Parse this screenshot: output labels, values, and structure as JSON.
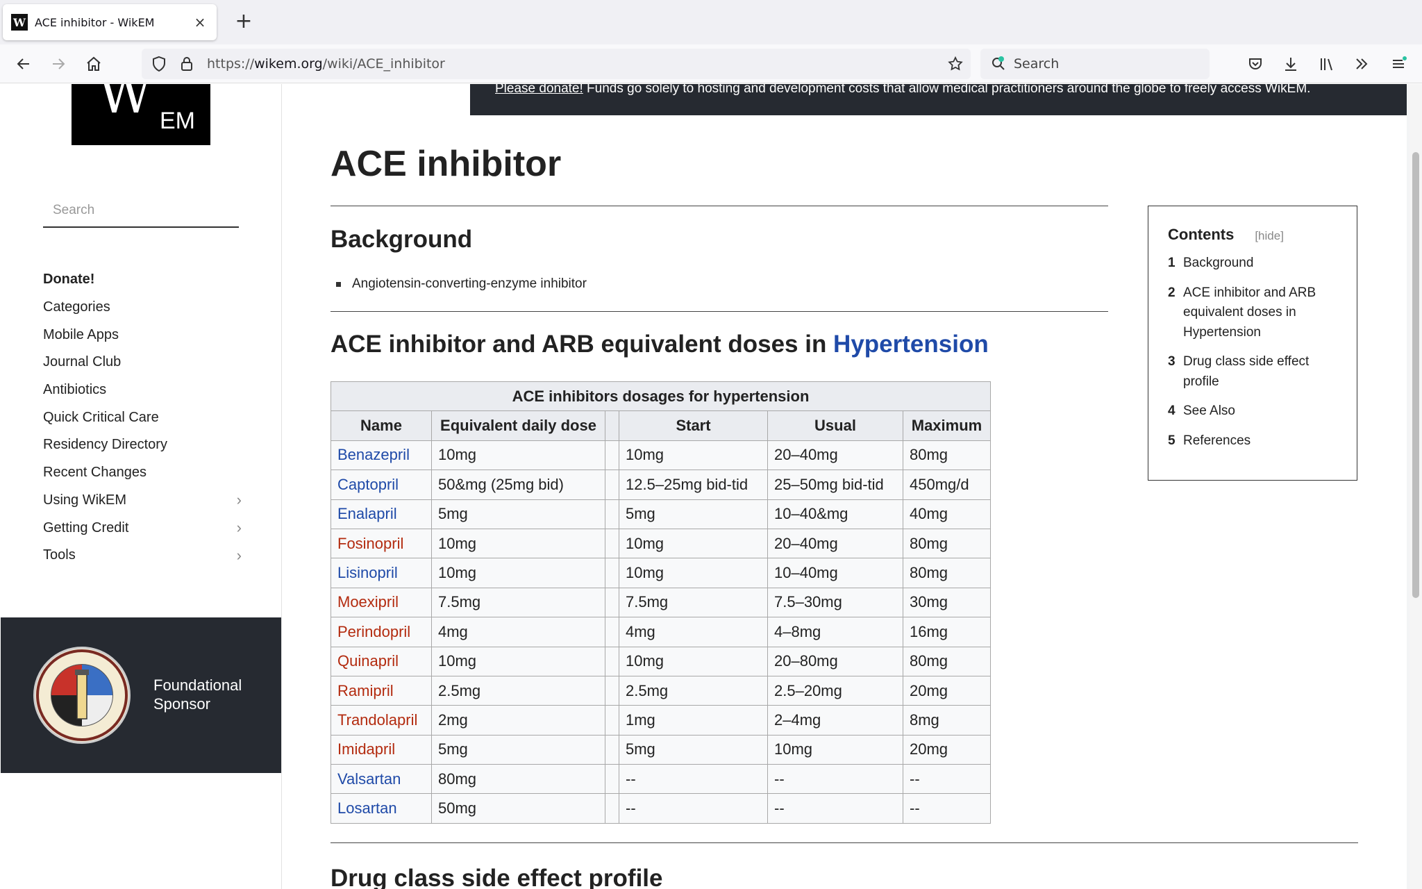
{
  "browser": {
    "tab_title": "ACE inhibitor - WikEM",
    "favicon_letter": "W",
    "new_tab": "+",
    "url_prefix": "https://",
    "url_domain": "wikem.org",
    "url_path": "/wiki/ACE_inhibitor",
    "search_placeholder": "Search"
  },
  "sidebar": {
    "logo_w": "W",
    "logo_em": "EM",
    "search_placeholder": "Search",
    "items": [
      {
        "label": "Donate!"
      },
      {
        "label": "Categories"
      },
      {
        "label": "Mobile Apps"
      },
      {
        "label": "Journal Club"
      },
      {
        "label": "Antibiotics"
      },
      {
        "label": "Quick Critical Care"
      },
      {
        "label": "Residency Directory"
      },
      {
        "label": "Recent Changes"
      },
      {
        "label": "Using WikEM"
      },
      {
        "label": "Getting Credit"
      },
      {
        "label": "Tools"
      }
    ],
    "sponsor_line1": "Foundational",
    "sponsor_line2": "Sponsor",
    "seal_top": "HARBOR-UCLA",
    "seal_bottom": "DEPARTMENT OF EMERGENCY MEDICINE"
  },
  "banner": {
    "link": "Please donate!",
    "text": " Funds go solely to hosting and development costs that allow medical practitioners around the globe to freely access WikEM."
  },
  "article": {
    "title": "ACE inhibitor",
    "background_heading": "Background",
    "background_bullet": "Angiotensin-converting-enzyme inhibitor",
    "doses_heading": "ACE inhibitor and ARB equivalent doses in ",
    "doses_heading_link": "Hypertension",
    "next_heading": "Drug class side effect profile"
  },
  "table": {
    "caption": "ACE inhibitors dosages for hypertension",
    "headers": [
      "Name",
      "Equivalent daily dose",
      "Start",
      "Usual",
      "Maximum"
    ],
    "rows": [
      [
        "Benazepril",
        "10mg",
        "10mg",
        "20–40mg",
        "80mg"
      ],
      [
        "Captopril",
        "50&mg (25mg bid)",
        "12.5–25mg bid-tid",
        "25–50mg bid-tid",
        "450mg/d"
      ],
      [
        "Enalapril",
        "5mg",
        "5mg",
        "10–40&mg",
        "40mg"
      ],
      [
        "Fosinopril",
        "10mg",
        "10mg",
        "20–40mg",
        "80mg"
      ],
      [
        "Lisinopril",
        "10mg",
        "10mg",
        "10–40mg",
        "80mg"
      ],
      [
        "Moexipril",
        "7.5mg",
        "7.5mg",
        "7.5–30mg",
        "30mg"
      ],
      [
        "Perindopril",
        "4mg",
        "4mg",
        "4–8mg",
        "16mg"
      ],
      [
        "Quinapril",
        "10mg",
        "10mg",
        "20–80mg",
        "80mg"
      ],
      [
        "Ramipril",
        "2.5mg",
        "2.5mg",
        "2.5–20mg",
        "20mg"
      ],
      [
        "Trandolapril",
        "2mg",
        "1mg",
        "2–4mg",
        "8mg"
      ],
      [
        "Imidapril",
        "5mg",
        "5mg",
        "10mg",
        "20mg"
      ],
      [
        "Valsartan",
        "80mg",
        "--",
        "--",
        "--"
      ],
      [
        "Losartan",
        "50mg",
        "--",
        "--",
        "--"
      ]
    ],
    "name_colors": [
      "blue",
      "blue",
      "blue",
      "red",
      "blue",
      "red",
      "red",
      "red",
      "red",
      "red",
      "red",
      "blue",
      "blue"
    ]
  },
  "toc": {
    "title": "Contents",
    "hide": "[hide]",
    "items": [
      {
        "num": "1",
        "label": "Background"
      },
      {
        "num": "2",
        "label": "ACE inhibitor and ARB equivalent doses in Hypertension"
      },
      {
        "num": "3",
        "label": "Drug class side effect profile"
      },
      {
        "num": "4",
        "label": "See Also"
      },
      {
        "num": "5",
        "label": "References"
      }
    ]
  },
  "colors": {
    "link_blue": "#1f4aa8",
    "link_red": "#b32b0f",
    "dark_panel": "#262a31"
  }
}
